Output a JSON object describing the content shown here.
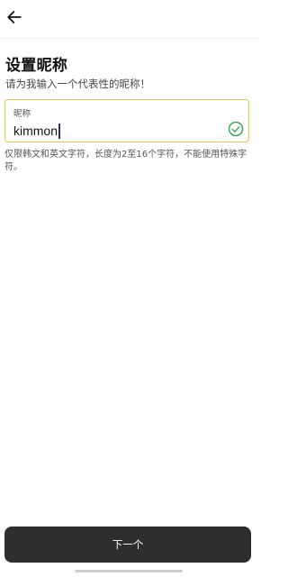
{
  "header": {
    "back_icon": "arrow-left-icon"
  },
  "page": {
    "title": "设置昵称",
    "subtitle": "请为我输入一个代表性的昵称！"
  },
  "nickname_field": {
    "label": "昵称",
    "value": "kimmon",
    "status_icon": "check-circle-icon",
    "accent_color": "#f2c14e",
    "valid_color": "#3aa657"
  },
  "hint": {
    "text": "仅限韩文和英文字符，长度为2至16个字符，不能使用特殊字符。"
  },
  "footer": {
    "next_label": "下一个",
    "button_color": "#2e2e2e"
  }
}
